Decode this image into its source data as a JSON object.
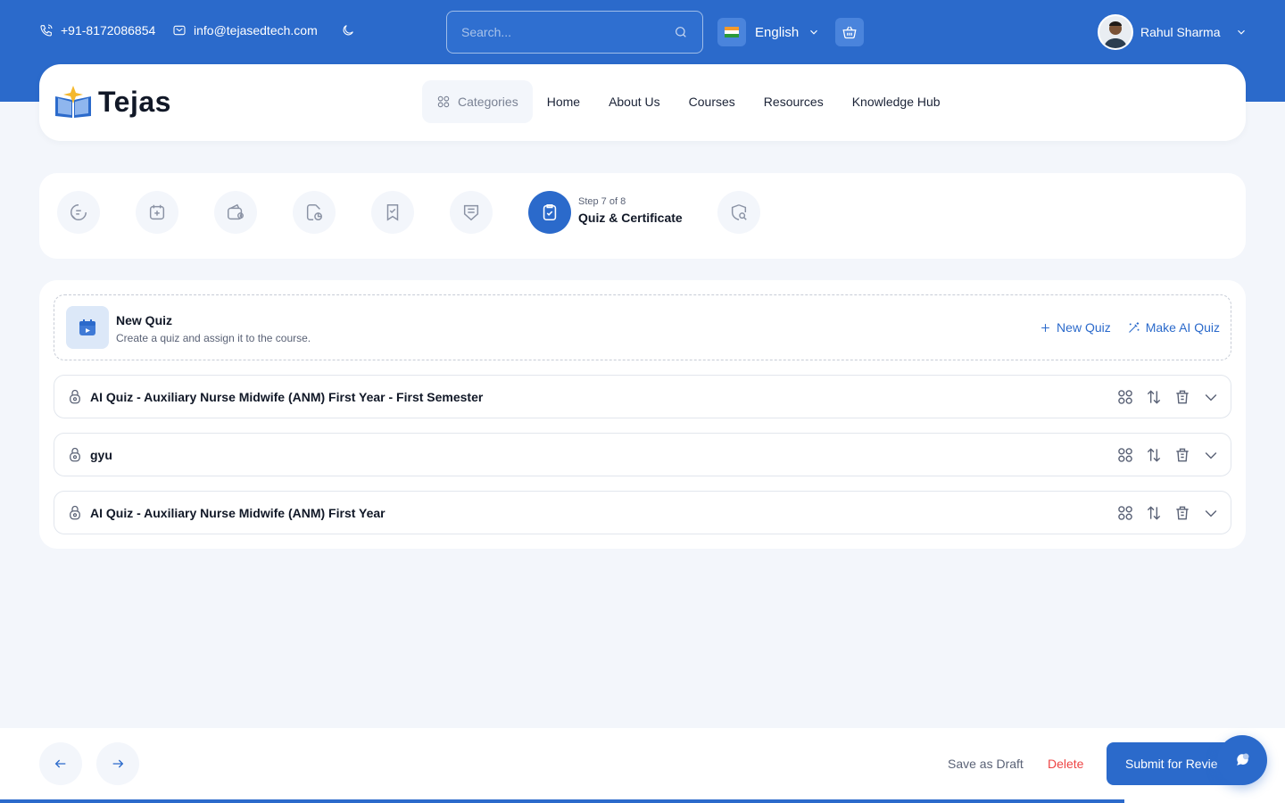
{
  "topbar": {
    "phone": "+91-8172086854",
    "email": "info@tejasedtech.com",
    "search_placeholder": "Search...",
    "language": "English",
    "user_name": "Rahul Sharma"
  },
  "brand": {
    "name": "Tejas"
  },
  "nav": {
    "categories": "Categories",
    "links": [
      "Home",
      "About Us",
      "Courses",
      "Resources",
      "Knowledge Hub"
    ]
  },
  "stepper": {
    "step_counter": "Step 7 of 8",
    "step_title": "Quiz & Certificate",
    "icons": [
      "info-icon",
      "calendar-add-icon",
      "wallet-icon",
      "document-chart-icon",
      "bookmark-check-icon",
      "shield-list-icon",
      "clipboard-check-icon",
      "search-badge-icon"
    ]
  },
  "new_quiz": {
    "title": "New Quiz",
    "subtitle": "Create a quiz and assign it to the course.",
    "add_label": "New Quiz",
    "ai_label": "Make AI Quiz"
  },
  "quizzes": [
    {
      "title": "AI Quiz - Auxiliary Nurse Midwife (ANM) First Year - First Semester"
    },
    {
      "title": "gyu"
    },
    {
      "title": "AI Quiz - Auxiliary Nurse Midwife (ANM) First Year"
    }
  ],
  "footer": {
    "save_draft": "Save as Draft",
    "delete": "Delete",
    "submit": "Submit for Review"
  },
  "colors": {
    "primary": "#2b6acb",
    "danger": "#ee4444",
    "background": "#f3f6fb"
  }
}
